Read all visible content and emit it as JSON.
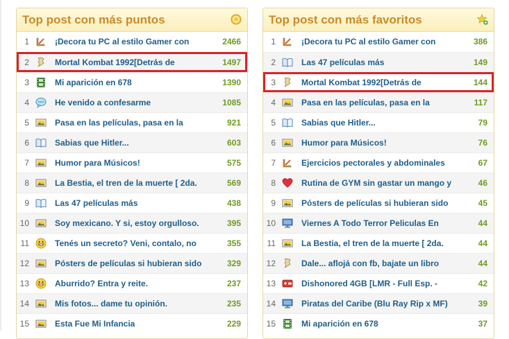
{
  "left_panel": {
    "title": "Top post con más puntos",
    "header_icon": "coin-icon",
    "highlight_rank": 2,
    "items": [
      {
        "rank": "1",
        "icon": "ruler-icon",
        "title": "¡Decora tu PC al estilo Gamer con",
        "points": "2466"
      },
      {
        "rank": "2",
        "icon": "parchment-icon",
        "title": "Mortal Kombat 1992[Detrás de",
        "points": "1497"
      },
      {
        "rank": "3",
        "icon": "film-icon",
        "title": "Mi aparición en 678",
        "points": "1390"
      },
      {
        "rank": "4",
        "icon": "speech-bubble-icon",
        "title": "He venido a confesarme",
        "points": "1085"
      },
      {
        "rank": "5",
        "icon": "image-icon",
        "title": "Pasa en las películas, pasa en la",
        "points": "921"
      },
      {
        "rank": "6",
        "icon": "book-icon",
        "title": "Sabias que Hitler...",
        "points": "603"
      },
      {
        "rank": "7",
        "icon": "image-icon",
        "title": "Humor para Músicos!",
        "points": "575"
      },
      {
        "rank": "8",
        "icon": "image-icon",
        "title": "La Bestia, el tren de la muerte [ 2da.",
        "points": "569"
      },
      {
        "rank": "9",
        "icon": "book-icon",
        "title": "Las 47 películas más",
        "points": "438"
      },
      {
        "rank": "10",
        "icon": "image-icon",
        "title": "Soy mexicano. Y si, estoy orgulloso.",
        "points": "395"
      },
      {
        "rank": "11",
        "icon": "smiley-icon",
        "title": "Tenés un secreto? Veni, contalo, no",
        "points": "355"
      },
      {
        "rank": "12",
        "icon": "image-icon",
        "title": "Pósters de películas si hubieran sido",
        "points": "329"
      },
      {
        "rank": "13",
        "icon": "smiley-icon",
        "title": "Aburrido? Entra y reite.",
        "points": "237"
      },
      {
        "rank": "14",
        "icon": "image-icon",
        "title": "Mis fotos... dame tu opinión.",
        "points": "235"
      },
      {
        "rank": "15",
        "icon": "image-icon",
        "title": "Esta Fue Mi Infancia",
        "points": "229"
      }
    ]
  },
  "right_panel": {
    "title": "Top post con más favoritos",
    "header_icon": "star-plus-icon",
    "highlight_rank": 3,
    "items": [
      {
        "rank": "1",
        "icon": "ruler-icon",
        "title": "¡Decora tu PC al estilo Gamer con",
        "points": "386"
      },
      {
        "rank": "2",
        "icon": "book-icon",
        "title": "Las 47 películas más",
        "points": "149"
      },
      {
        "rank": "3",
        "icon": "parchment-icon",
        "title": "Mortal Kombat 1992[Detrás de",
        "points": "144"
      },
      {
        "rank": "4",
        "icon": "image-icon",
        "title": "Pasa en las películas, pasa en la",
        "points": "117"
      },
      {
        "rank": "5",
        "icon": "book-icon",
        "title": "Sabias que Hitler...",
        "points": "79"
      },
      {
        "rank": "6",
        "icon": "image-icon",
        "title": "Humor para Músicos!",
        "points": "76"
      },
      {
        "rank": "7",
        "icon": "ruler-icon",
        "title": "Ejercicios pectorales y abdominales",
        "points": "67"
      },
      {
        "rank": "8",
        "icon": "heart-icon",
        "title": "Rutina de GYM sin gastar un mango y",
        "points": "46"
      },
      {
        "rank": "9",
        "icon": "image-icon",
        "title": "Pósters de películas si hubieran sido",
        "points": "45"
      },
      {
        "rank": "10",
        "icon": "monitor-icon",
        "title": "Viernes A Todo Terror Peliculas En",
        "points": "44"
      },
      {
        "rank": "11",
        "icon": "image-icon",
        "title": "La Bestia, el tren de la muerte [ 2da.",
        "points": "44"
      },
      {
        "rank": "12",
        "icon": "parchment-icon",
        "title": "Dale... aflojá con fb, bajate un libro",
        "points": "44"
      },
      {
        "rank": "13",
        "icon": "gamepad-icon",
        "title": "Dishonored 4GB [LMR - Full Esp. -",
        "points": "42"
      },
      {
        "rank": "14",
        "icon": "monitor-icon",
        "title": "Piratas del Caribe (Blu Ray Rip x MF)",
        "points": "39"
      },
      {
        "rank": "15",
        "icon": "film-icon",
        "title": "Mi aparición en 678",
        "points": "37"
      }
    ]
  },
  "colors": {
    "title": "#c98b2a",
    "link": "#1f5e8a",
    "points": "#6f9a22",
    "highlight": "#d8232a"
  }
}
